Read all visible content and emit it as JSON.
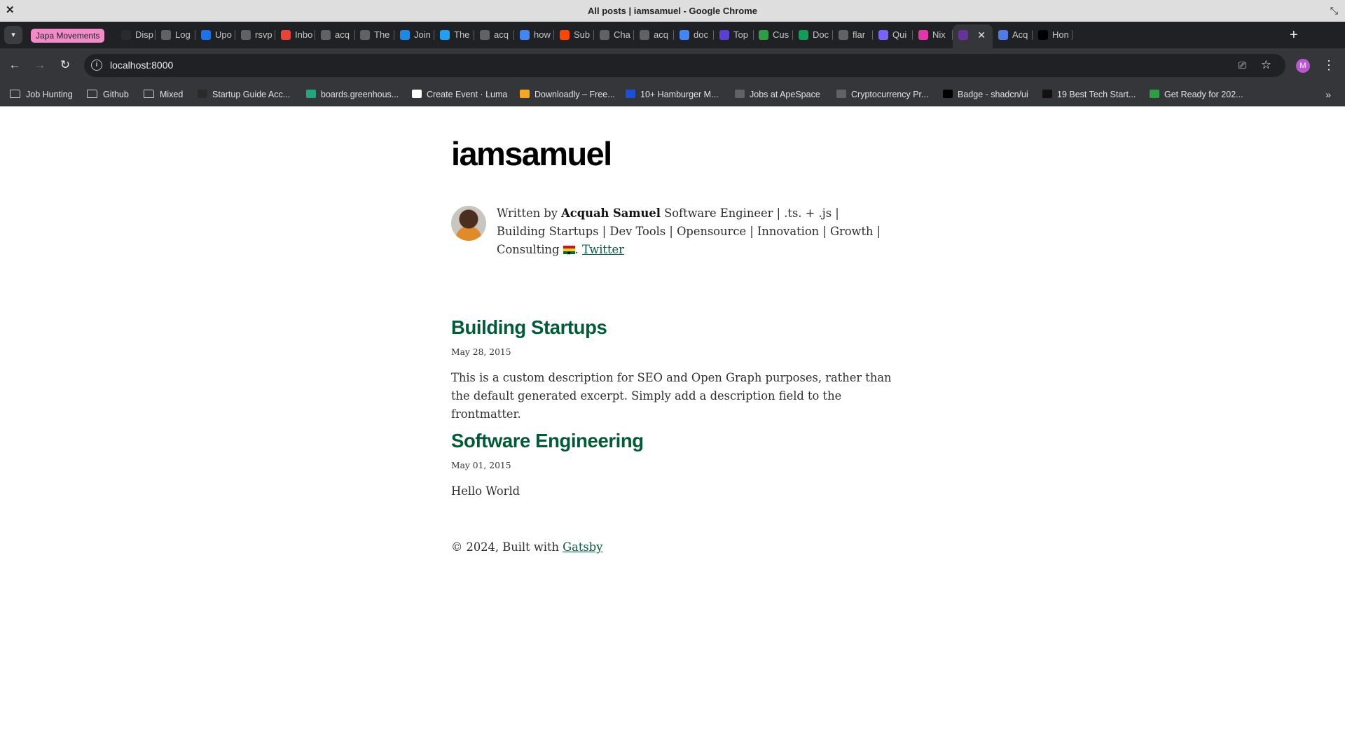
{
  "window": {
    "title": "All posts | iamsamuel - Google Chrome"
  },
  "tab_group": {
    "label": "Japa Movements",
    "color": "#f28cc9"
  },
  "tabs": [
    {
      "label": "Disp",
      "icon": "dark-circle-icon",
      "color": "#2b2b2b"
    },
    {
      "label": "Log",
      "icon": "chat-icon",
      "color": "#5f6368"
    },
    {
      "label": "Upo",
      "icon": "blue-circle-icon",
      "color": "#1a73e8"
    },
    {
      "label": "rsvp",
      "icon": "shield-w-icon",
      "color": "#5f6368"
    },
    {
      "label": "Inbo",
      "icon": "gmail-icon",
      "color": "#ea4335"
    },
    {
      "label": "acq",
      "icon": "github-icon",
      "color": "#5f6368"
    },
    {
      "label": "The",
      "icon": "globe-icon",
      "color": "#5f6368"
    },
    {
      "label": "Join",
      "icon": "play-icon",
      "color": "#1e88e5"
    },
    {
      "label": "The",
      "icon": "bird-icon",
      "color": "#1da1f2"
    },
    {
      "label": "acq",
      "icon": "github-icon",
      "color": "#5f6368"
    },
    {
      "label": "how",
      "icon": "google-icon",
      "color": "#4285f4"
    },
    {
      "label": "Sub",
      "icon": "reddit-icon",
      "color": "#ff4500"
    },
    {
      "label": "Cha",
      "icon": "openai-icon",
      "color": "#5f6368"
    },
    {
      "label": "acq",
      "icon": "github-icon",
      "color": "#5f6368"
    },
    {
      "label": "doc",
      "icon": "google-icon",
      "color": "#4285f4"
    },
    {
      "label": "Top",
      "icon": "bars-icon",
      "color": "#5b3fd6"
    },
    {
      "label": "Cus",
      "icon": "cloud-icon",
      "color": "#2e9e44"
    },
    {
      "label": "Doc",
      "icon": "docs-icon",
      "color": "#0f9d58"
    },
    {
      "label": "flar",
      "icon": "github-icon",
      "color": "#5f6368"
    },
    {
      "label": "Qui",
      "icon": "grid-icon",
      "color": "#7b61ff"
    },
    {
      "label": "Nix",
      "icon": "hex-icon",
      "color": "#e535ab"
    },
    {
      "label": "",
      "icon": "gatsby-icon",
      "color": "#663399",
      "active": true
    },
    {
      "label": "Acq",
      "icon": "code-icon",
      "color": "#4f7be8"
    },
    {
      "label": "Hon",
      "icon": "x-icon",
      "color": "#000000"
    }
  ],
  "toolbar": {
    "url": "localhost:8000",
    "profile_initial": "M"
  },
  "bookmarks": [
    {
      "label": "Job Hunting",
      "type": "folder"
    },
    {
      "label": "Github",
      "type": "folder"
    },
    {
      "label": "Mixed",
      "type": "folder"
    },
    {
      "label": "Startup Guide Acc...",
      "icon": "notion-icon",
      "color": "#2b2b2b"
    },
    {
      "label": "boards.greenhous...",
      "icon": "greenhouse-icon",
      "color": "#24a47f"
    },
    {
      "label": "Create Event · Luma",
      "icon": "luma-icon",
      "color": "#ffffff"
    },
    {
      "label": "Downloadly – Free...",
      "icon": "downloadly-icon",
      "color": "#f5a623"
    },
    {
      "label": "10+ Hamburger M...",
      "icon": "rt-icon",
      "color": "#1a4fd6"
    },
    {
      "label": "Jobs at ApeSpace",
      "icon": "globe-icon",
      "color": "#5f6368"
    },
    {
      "label": "Cryptocurrency Pr...",
      "icon": "globe-icon",
      "color": "#5f6368"
    },
    {
      "label": "Badge - shadcn/ui",
      "icon": "shadcn-icon",
      "color": "#000000"
    },
    {
      "label": "19 Best Tech Start...",
      "icon": "i-icon",
      "color": "#111111"
    },
    {
      "label": "Get Ready for 202...",
      "icon": "sb-icon",
      "color": "#2e9e44"
    }
  ],
  "page": {
    "site_title": "iamsamuel",
    "bio": {
      "prefix": "Written by ",
      "author": "Acquah Samuel",
      "text": " Software Engineer | .ts. + .js | Building Startups | Dev Tools | Opensource | Innovation | Growth | Consulting ",
      "flag_suffix": ". ",
      "twitter": "Twitter"
    },
    "posts": [
      {
        "title": "Building Startups",
        "date": "May 28, 2015",
        "description": "This is a custom description for SEO and Open Graph purposes, rather than the default generated excerpt. Simply add a description field to the frontmatter."
      },
      {
        "title": "Software Engineering",
        "date": "May 01, 2015",
        "description": "Hello World"
      }
    ],
    "footer": {
      "text": "© 2024, Built with ",
      "link": "Gatsby"
    },
    "link_color": "#005b38"
  }
}
